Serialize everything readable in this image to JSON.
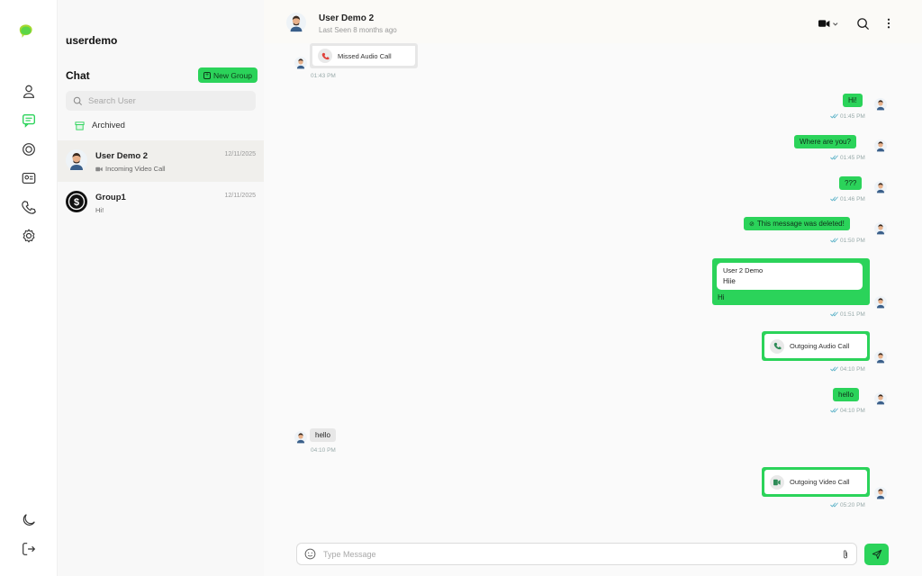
{
  "sidebar": {
    "current_user": "userdemo"
  },
  "chat_list": {
    "heading": "Chat",
    "new_group_label": "New Group",
    "search_placeholder": "Search User",
    "archived_label": "Archived",
    "items": [
      {
        "name": "User Demo 2",
        "preview": "Incoming Video Call",
        "date": "12/11/2025"
      },
      {
        "name": "Group1",
        "preview": "Hi!",
        "date": "12/11/2025"
      }
    ]
  },
  "conversation": {
    "contact_name": "User Demo 2",
    "status": "Last Seen 8 months ago",
    "messages": [
      {
        "text": "Missed Audio Call",
        "time": "01:43 PM"
      },
      {
        "text": "Hi!",
        "time": "01:45 PM"
      },
      {
        "text": "Where are you?",
        "time": "01:45 PM"
      },
      {
        "text": "???",
        "time": "01:46 PM"
      },
      {
        "text": "This message was deleted!",
        "time": "01:50 PM"
      },
      {
        "reply_author": "User 2 Demo",
        "reply_text": "Hiie",
        "text": "Hi",
        "time": "01:51 PM"
      },
      {
        "text": "Outgoing Audio Call",
        "time": "04:10 PM"
      },
      {
        "text": "hello",
        "time": "04:10 PM"
      },
      {
        "text": "hello",
        "time": "04:10 PM"
      },
      {
        "text": "Outgoing Video Call",
        "time": "05:20 PM"
      }
    ]
  },
  "composer": {
    "placeholder": "Type Message"
  },
  "colors": {
    "accent": "#2bd35a",
    "missed": "#e0413a"
  }
}
